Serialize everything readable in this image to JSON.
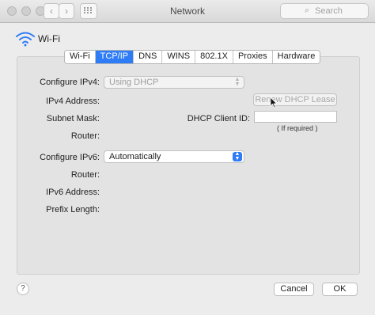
{
  "window": {
    "title": "Network"
  },
  "toolbar": {
    "back_icon": "chevron-left-icon",
    "forward_icon": "chevron-right-icon",
    "grid_icon": "show-all-grid-icon",
    "search_placeholder": "Search"
  },
  "interface": {
    "name": "Wi-Fi",
    "icon": "wifi-icon"
  },
  "tabs": [
    {
      "label": "Wi-Fi",
      "active": false
    },
    {
      "label": "TCP/IP",
      "active": true
    },
    {
      "label": "DNS",
      "active": false
    },
    {
      "label": "WINS",
      "active": false
    },
    {
      "label": "802.1X",
      "active": false
    },
    {
      "label": "Proxies",
      "active": false
    },
    {
      "label": "Hardware",
      "active": false
    }
  ],
  "ipv4": {
    "configure_label": "Configure IPv4:",
    "configure_value": "Using DHCP",
    "address_label": "IPv4 Address:",
    "subnet_label": "Subnet Mask:",
    "router_label": "Router:",
    "renew_button": "Renew DHCP Lease",
    "client_id_label": "DHCP Client ID:",
    "client_id_value": "",
    "client_id_hint": "( If required )"
  },
  "ipv6": {
    "configure_label": "Configure IPv6:",
    "configure_value": "Automatically",
    "router_label": "Router:",
    "address_label": "IPv6 Address:",
    "prefix_label": "Prefix Length:"
  },
  "footer": {
    "help": "?",
    "cancel": "Cancel",
    "ok": "OK"
  },
  "colors": {
    "accent": "#2e7cf6",
    "background": "#ececec"
  }
}
